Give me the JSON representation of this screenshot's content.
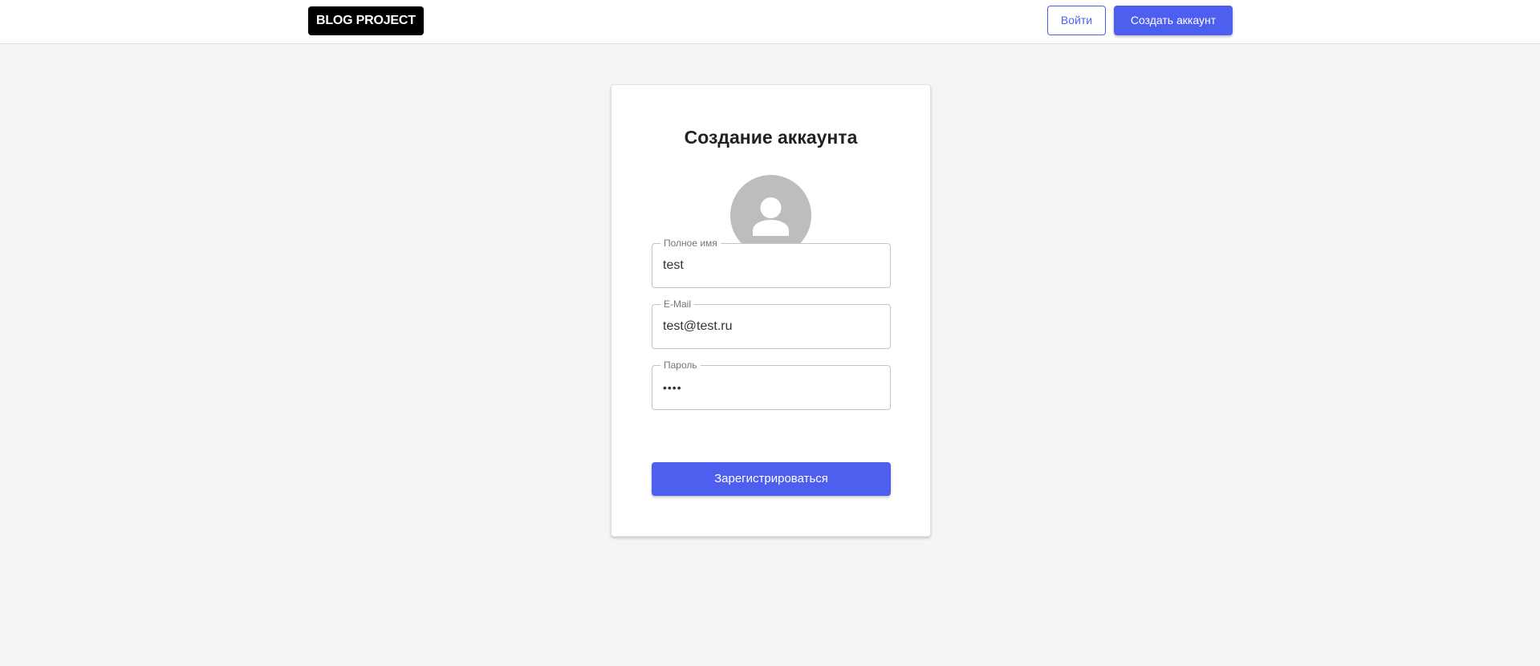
{
  "header": {
    "logo_text": "BLOG PROJECT",
    "login_label": "Войти",
    "register_label": "Создать аккаунт"
  },
  "form": {
    "title": "Создание аккаунта",
    "avatar_icon": "user-avatar-icon",
    "fields": [
      {
        "label": "Полное имя",
        "value": "test"
      },
      {
        "label": "E-Mail",
        "value": "test@test.ru"
      },
      {
        "label": "Пароль",
        "value": "••••"
      }
    ],
    "submit_label": "Зарегистрироваться"
  },
  "colors": {
    "accent": "#4e5ff0",
    "background": "#f5f5f5",
    "logo_background": "#000000",
    "avatar_background": "#bdbdbd"
  }
}
